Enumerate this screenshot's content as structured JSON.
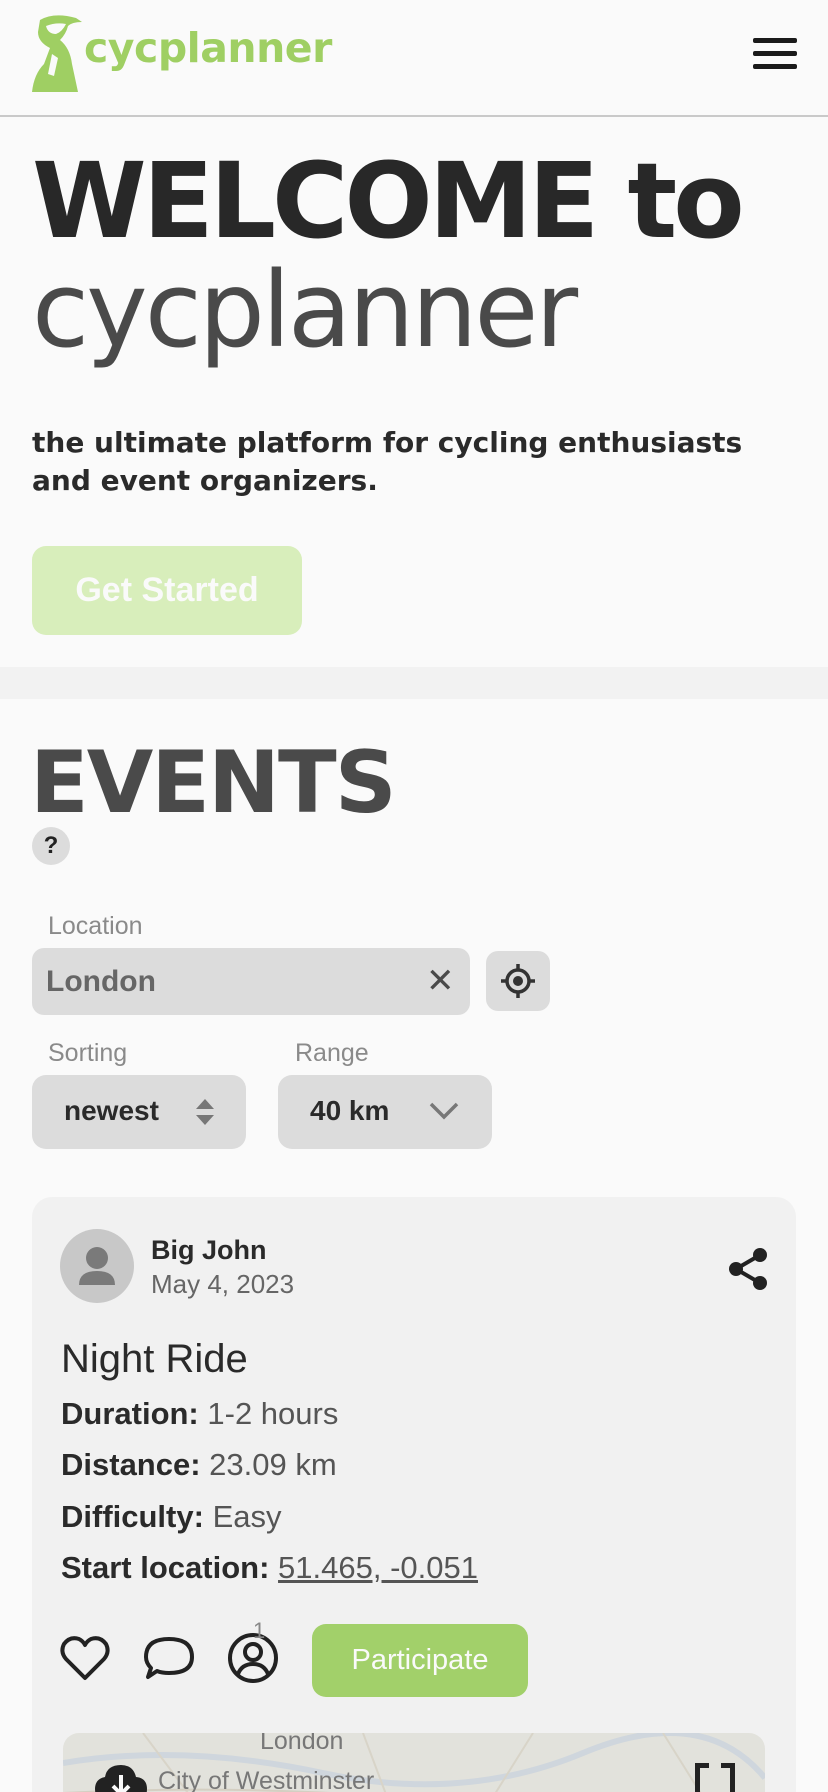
{
  "header": {
    "logo_text": "cycplanner",
    "menu_icon": "hamburger-icon"
  },
  "hero": {
    "title_strong": "WELCOME to",
    "title_light": "cycplanner",
    "subtitle": "the ultimate platform for cycling enthusiasts and event organizers.",
    "cta_label": "Get Started"
  },
  "events": {
    "title": "EVENTS",
    "help_label": "?",
    "location": {
      "label": "Location",
      "value": "London"
    },
    "sorting": {
      "label": "Sorting",
      "value": "newest"
    },
    "range": {
      "label": "Range",
      "value": "40 km"
    },
    "cards": [
      {
        "author": "Big John",
        "date": "May 4, 2023",
        "title": "Night Ride",
        "duration_label": "Duration:",
        "duration": "1-2 hours",
        "distance_label": "Distance:",
        "distance": "23.09 km",
        "difficulty_label": "Difficulty:",
        "difficulty": "Easy",
        "start_label": "Start location:",
        "start": "51.465, -0.051",
        "participants_count": "1",
        "participate_label": "Participate",
        "map": {
          "label_1": "London",
          "label_2": "City of Westminster"
        }
      }
    ]
  },
  "colors": {
    "brand_green": "#9fcf63",
    "button_green": "#a2d06a",
    "cta_disabled": "#d8eebb"
  }
}
